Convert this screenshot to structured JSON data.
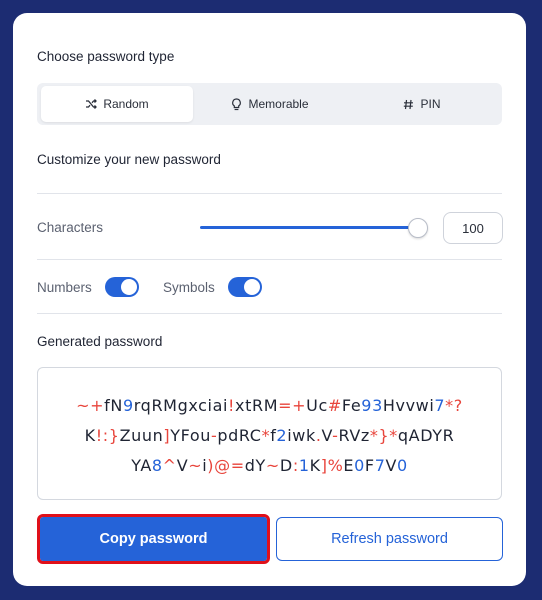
{
  "type_section": {
    "title": "Choose password type"
  },
  "tabs": [
    {
      "label": "Random",
      "icon": "shuffle-icon",
      "active": true
    },
    {
      "label": "Memorable",
      "icon": "lightbulb-icon",
      "active": false
    },
    {
      "label": "PIN",
      "icon": "hash-icon",
      "active": false
    }
  ],
  "customize": {
    "title": "Customize your new password"
  },
  "characters": {
    "label": "Characters",
    "value": "100",
    "slider_fraction": 1.0
  },
  "options": {
    "numbers_label": "Numbers",
    "numbers_on": true,
    "symbols_label": "Symbols",
    "symbols_on": true
  },
  "generated": {
    "title": "Generated password",
    "lines": [
      "~+fN9rqRMgxciai!xtRM=+Uc#Fe93Hvvwi7*?",
      "K!:}Zuun]YFou-pdRC*f2iwk.V-RVz*}*qADYR",
      "YA8^V~i)@=dY~D:1K]%E0F7V0"
    ]
  },
  "buttons": {
    "copy": "Copy password",
    "refresh": "Refresh password"
  },
  "colors": {
    "accent": "#2563d8",
    "symbol": "#e8453c",
    "background": "#1c2c72"
  }
}
